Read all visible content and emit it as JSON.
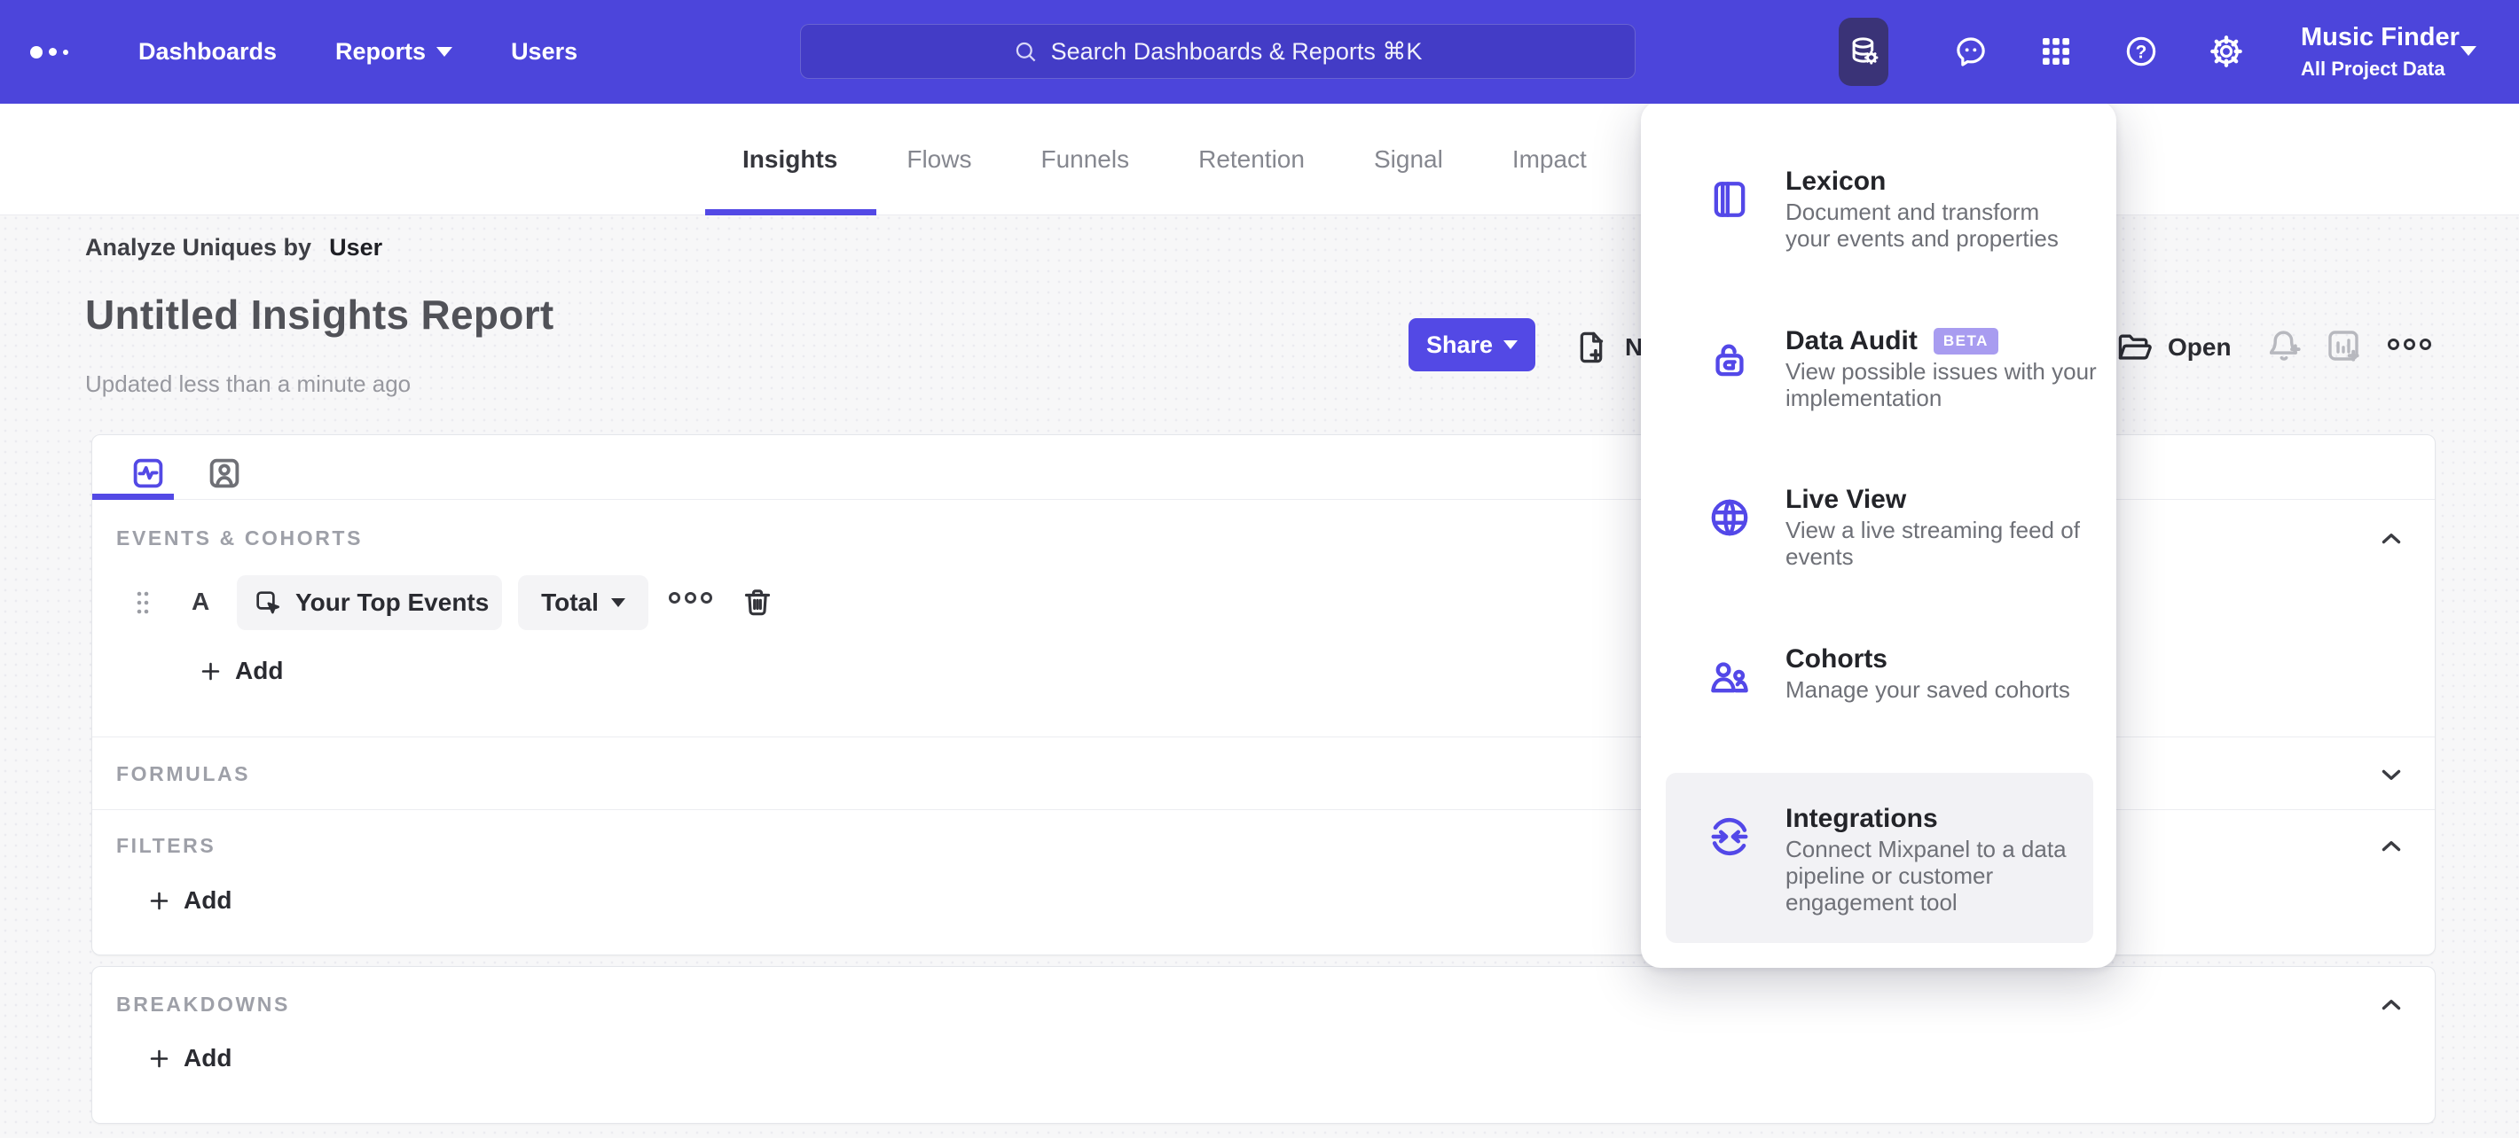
{
  "topbar": {
    "nav": [
      {
        "label": "Dashboards"
      },
      {
        "label": "Reports"
      },
      {
        "label": "Users"
      }
    ],
    "search": {
      "placeholder": "Search Dashboards & Reports ⌘K"
    },
    "project": {
      "name": "Music Finder",
      "scope": "All Project Data"
    }
  },
  "tabs": {
    "items": [
      {
        "label": "Insights"
      },
      {
        "label": "Flows"
      },
      {
        "label": "Funnels"
      },
      {
        "label": "Retention"
      },
      {
        "label": "Signal"
      },
      {
        "label": "Impact"
      }
    ],
    "active": "Insights"
  },
  "report": {
    "analyze_label": "Analyze Uniques by",
    "analyze_value": "User",
    "title": "Untitled Insights Report",
    "updated": "Updated less than a minute ago",
    "share_label": "Share",
    "new_label": "New",
    "open_label": "Open"
  },
  "builder": {
    "events_header": "EVENTS & COHORTS",
    "row": {
      "letter": "A",
      "event": "Your Top Events",
      "metric": "Total"
    },
    "add_label": "Add",
    "formulas_header": "FORMULAS",
    "filters_header": "FILTERS",
    "breakdowns_header": "BREAKDOWNS"
  },
  "menu": {
    "items": [
      {
        "title": "Lexicon",
        "desc": "Document and transform\nyour events and properties"
      },
      {
        "title": "Data Audit",
        "badge": "BETA",
        "desc": "View possible issues with your\nimplementation"
      },
      {
        "title": "Live View",
        "desc": "View a live streaming feed of\nevents"
      },
      {
        "title": "Cohorts",
        "desc": "Manage your saved cohorts"
      },
      {
        "title": "Integrations",
        "desc": "Connect Mixpanel to a data\npipeline or customer\nengagement tool"
      }
    ]
  },
  "colors": {
    "brand": "#4C45DB",
    "accent": "#5349E5",
    "badge": "#A89CF0",
    "active_pill": "#3A3377"
  }
}
